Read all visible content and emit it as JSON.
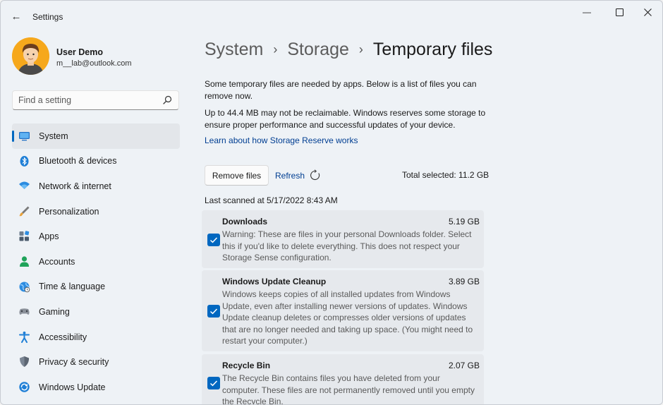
{
  "window": {
    "title": "Settings",
    "back_glyph": "←",
    "minimize_glyph": "—",
    "maximize_glyph": "☐",
    "close_glyph": "✕"
  },
  "user": {
    "name": "User Demo",
    "email": "m__lab@outlook.com"
  },
  "search": {
    "placeholder": "Find a setting"
  },
  "sidebar": {
    "items": [
      {
        "label": "System",
        "icon": "system-icon",
        "active": true
      },
      {
        "label": "Bluetooth & devices",
        "icon": "bluetooth-icon"
      },
      {
        "label": "Network & internet",
        "icon": "network-icon"
      },
      {
        "label": "Personalization",
        "icon": "personalization-icon"
      },
      {
        "label": "Apps",
        "icon": "apps-icon"
      },
      {
        "label": "Accounts",
        "icon": "accounts-icon"
      },
      {
        "label": "Time & language",
        "icon": "time-language-icon"
      },
      {
        "label": "Gaming",
        "icon": "gaming-icon"
      },
      {
        "label": "Accessibility",
        "icon": "accessibility-icon"
      },
      {
        "label": "Privacy & security",
        "icon": "privacy-icon"
      },
      {
        "label": "Windows Update",
        "icon": "windows-update-icon"
      }
    ]
  },
  "breadcrumb": {
    "items": [
      "System",
      "Storage",
      "Temporary files"
    ],
    "separator": "›"
  },
  "main": {
    "description_1": "Some temporary files are needed by apps. Below is a list of files you can remove now.",
    "description_2": "Up to 44.4 MB may not be reclaimable. Windows reserves some storage to ensure proper performance and successful updates of your device.",
    "learn_link": "Learn about how Storage Reserve works",
    "remove_button": "Remove files",
    "refresh_label": "Refresh",
    "total_selected": "Total selected: 11.2 GB",
    "last_scanned": "Last scanned at 5/17/2022 8:43 AM",
    "files": [
      {
        "title": "Downloads",
        "size": "5.19 GB",
        "checked": true,
        "description": "Warning: These are files in your personal Downloads folder. Select this if you'd like to delete everything. This does not respect your Storage Sense configuration."
      },
      {
        "title": "Windows Update Cleanup",
        "size": "3.89 GB",
        "checked": true,
        "description": "Windows keeps copies of all installed updates from Windows Update, even after installing newer versions of updates. Windows Update cleanup deletes or compresses older versions of updates that are no longer needed and taking up space. (You might need to restart your computer.)"
      },
      {
        "title": "Recycle Bin",
        "size": "2.07 GB",
        "checked": true,
        "description": "The Recycle Bin contains files you have deleted from your computer. These files are not permanently removed until you empty the Recycle Bin."
      }
    ]
  },
  "colors": {
    "accent": "#0067c0",
    "link": "#003e92",
    "active_bg": "#e3e6ea"
  }
}
